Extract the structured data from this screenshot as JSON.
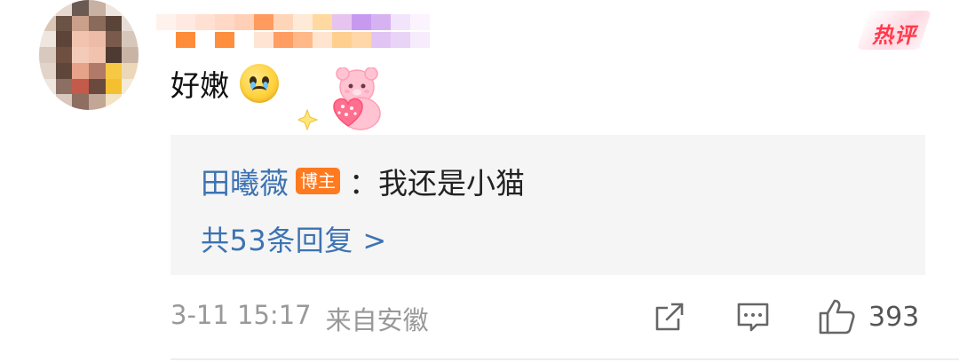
{
  "comment": {
    "text": "好嫩",
    "emoji": "crying-face-icon",
    "sticker": "pink-bear-heart-sticker"
  },
  "hot_tag": {
    "label": "热评",
    "color": "#ff3b4d"
  },
  "reply": {
    "author": "田曦薇",
    "badge": "博主",
    "separator": "：",
    "text": "我还是小猫",
    "count_label": "共53条回复 >"
  },
  "footer": {
    "time": "3-11 15:17",
    "location": "来自安徽",
    "share_icon": "share-icon",
    "comment_icon": "comment-icon",
    "like_icon": "thumbs-up-icon",
    "like_count": "393"
  },
  "colors": {
    "link": "#3d73b2",
    "badge": "#ff7a1f",
    "meta": "#999999",
    "reply_bg": "#f5f5f5"
  }
}
